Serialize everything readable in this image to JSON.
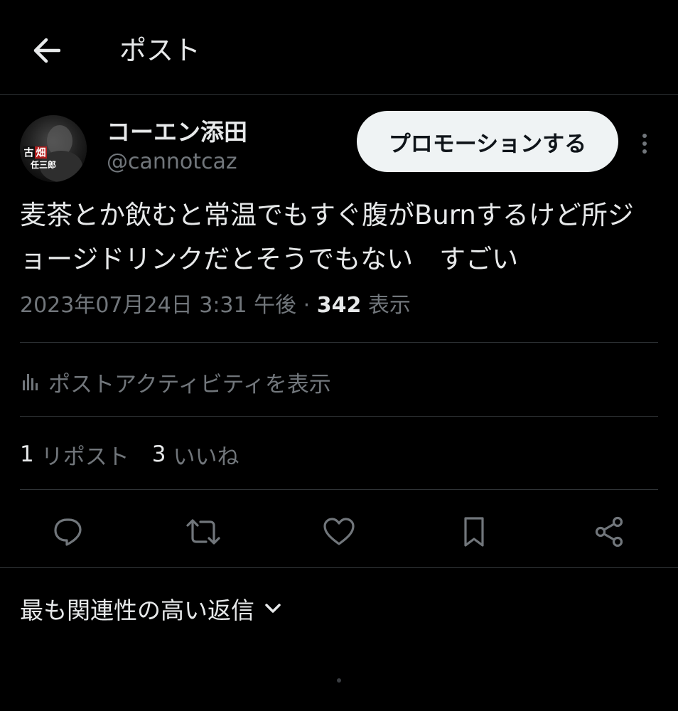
{
  "header": {
    "title": "ポスト",
    "back_icon": "arrow-left-icon"
  },
  "author": {
    "display_name": "コーエン添田",
    "handle": "@cannotcaz",
    "avatar_text": [
      "古",
      "畑",
      "任三郎"
    ]
  },
  "promote_button": {
    "label": "プロモーションする"
  },
  "more_icon": "more-vertical-icon",
  "tweet": {
    "text": "麦茶とか飲むと常温でもすぐ腹がBurnするけど所ジョージドリンクだとそうでもない　すごい",
    "timestamp": "2023年07月24日 3:31 午後",
    "separator": " · ",
    "views_count": "342",
    "views_label": " 表示"
  },
  "activity": {
    "label": "ポストアクティビティを表示",
    "icon": "bar-chart-icon"
  },
  "stats": {
    "reposts_count": "1",
    "reposts_label": "リポスト",
    "likes_count": "3",
    "likes_label": "いいね"
  },
  "actions": [
    {
      "name": "reply-icon"
    },
    {
      "name": "repost-icon"
    },
    {
      "name": "like-icon"
    },
    {
      "name": "bookmark-icon"
    },
    {
      "name": "share-icon"
    }
  ],
  "replies_sort": {
    "label": "最も関連性の高い返信",
    "icon": "chevron-down-icon"
  },
  "colors": {
    "background": "#000000",
    "text_primary": "#e7e9ea",
    "text_secondary": "#71767b",
    "divider": "#2f3336",
    "promo_button_bg": "#eff3f4"
  }
}
